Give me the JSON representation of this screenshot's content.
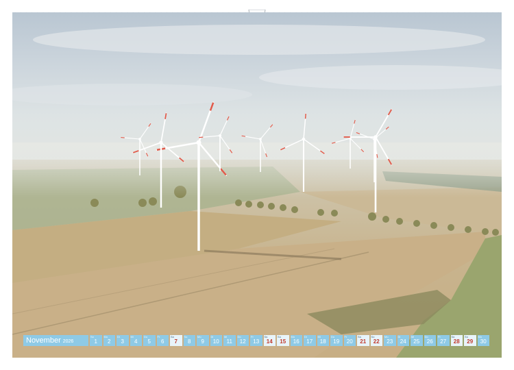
{
  "calendar": {
    "month": "November",
    "year": "2026",
    "days": [
      {
        "wd": "So",
        "num": "1",
        "sunday": false
      },
      {
        "wd": "Mo",
        "num": "2",
        "sunday": false
      },
      {
        "wd": "Di",
        "num": "3",
        "sunday": false
      },
      {
        "wd": "Mi",
        "num": "4",
        "sunday": false
      },
      {
        "wd": "Do",
        "num": "5",
        "sunday": false
      },
      {
        "wd": "Fr",
        "num": "6",
        "sunday": false
      },
      {
        "wd": "Sa",
        "num": "7",
        "sunday": true
      },
      {
        "wd": "So",
        "num": "8",
        "sunday": false
      },
      {
        "wd": "Mo",
        "num": "9",
        "sunday": false
      },
      {
        "wd": "Di",
        "num": "10",
        "sunday": false
      },
      {
        "wd": "Mi",
        "num": "11",
        "sunday": false
      },
      {
        "wd": "Do",
        "num": "12",
        "sunday": false
      },
      {
        "wd": "Fr",
        "num": "13",
        "sunday": false
      },
      {
        "wd": "Sa",
        "num": "14",
        "sunday": true
      },
      {
        "wd": "So",
        "num": "15",
        "sunday": true
      },
      {
        "wd": "Mo",
        "num": "16",
        "sunday": false
      },
      {
        "wd": "Di",
        "num": "17",
        "sunday": false
      },
      {
        "wd": "Mi",
        "num": "18",
        "sunday": false
      },
      {
        "wd": "Do",
        "num": "19",
        "sunday": false
      },
      {
        "wd": "Fr",
        "num": "20",
        "sunday": false
      },
      {
        "wd": "Sa",
        "num": "21",
        "sunday": true
      },
      {
        "wd": "So",
        "num": "22",
        "sunday": true
      },
      {
        "wd": "Mo",
        "num": "23",
        "sunday": false
      },
      {
        "wd": "Di",
        "num": "24",
        "sunday": false
      },
      {
        "wd": "Mi",
        "num": "25",
        "sunday": false
      },
      {
        "wd": "Do",
        "num": "26",
        "sunday": false
      },
      {
        "wd": "Fr",
        "num": "27",
        "sunday": false
      },
      {
        "wd": "Sa",
        "num": "28",
        "sunday": true
      },
      {
        "wd": "So",
        "num": "29",
        "sunday": true
      },
      {
        "wd": "Mo",
        "num": "30",
        "sunday": false
      }
    ]
  },
  "colors": {
    "calendar_cell": "#8ecae6",
    "weekend_text": "#c0392b"
  },
  "icons": [
    "binding-hole-icon",
    "wire-binding-icon"
  ]
}
